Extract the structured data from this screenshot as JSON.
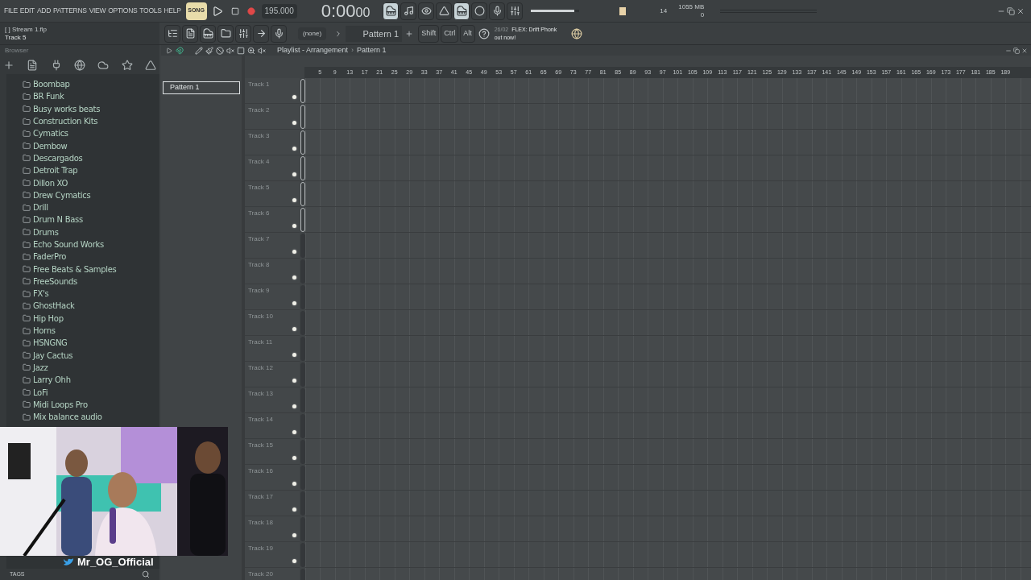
{
  "menu": [
    "FILE",
    "EDIT",
    "ADD",
    "PATTERNS",
    "VIEW",
    "OPTIONS",
    "TOOLS",
    "HELP"
  ],
  "transport": {
    "mode": "SONG",
    "tempo": "195.000",
    "time": "0:00",
    "time_sub": "00"
  },
  "master_volume": {
    "level": 0.9
  },
  "monitor": {
    "cpu": "14",
    "memory": "1055 MB",
    "polyphony": "0"
  },
  "hint": {
    "file": "[  ] Stream 1.flp",
    "line": "Track 5"
  },
  "toolbar": {
    "channel": "(none)",
    "pattern": "Pattern 1",
    "keys": [
      "Shift",
      "Ctrl",
      "Alt"
    ],
    "news_date": "26/02",
    "news": "FLEX: Drift Phonk",
    "news_line2": "out now!"
  },
  "browser": {
    "title": "Browser",
    "folders": [
      "Boombap",
      "BR Funk",
      "Busy works beats",
      "Construction Kits",
      "Cymatics",
      "Dembow",
      "Descargados",
      "Detroit Trap",
      "Dillon XO",
      "Drew Cymatics",
      "Drill",
      "Drum N Bass",
      "Drums",
      "Echo Sound Works",
      "FaderPro",
      "Free Beats & Samples",
      "FreeSounds",
      "FX's",
      "GhostHack",
      "Hip Hop",
      "Horns",
      "HSNGNG",
      "Jay Cactus",
      "Jazz",
      "Larry Ohh",
      "LoFi",
      "Midi Loops Pro",
      "Mix balance audio"
    ],
    "tags": "TAGS"
  },
  "overlay": {
    "handle": "Mr_OG_Official"
  },
  "playlist": {
    "title": "Playlist - Arrangement",
    "separator": "›",
    "pattern": "Pattern 1",
    "patterns": [
      {
        "name": "Pattern 1",
        "selected": true
      }
    ],
    "ruler": [
      "5",
      "9",
      "13",
      "17",
      "21",
      "25",
      "29",
      "33",
      "37",
      "41",
      "45",
      "49",
      "53",
      "57",
      "61",
      "65",
      "69",
      "73",
      "77",
      "81",
      "85",
      "89",
      "93",
      "97",
      "101",
      "105",
      "109",
      "113",
      "117",
      "121",
      "125",
      "129",
      "133",
      "137",
      "141",
      "145",
      "149",
      "153",
      "157",
      "161",
      "165",
      "169",
      "173",
      "177",
      "181",
      "185",
      "189"
    ],
    "tracks": [
      {
        "name": "Track 1",
        "selected": true
      },
      {
        "name": "Track 2",
        "selected": true
      },
      {
        "name": "Track 3",
        "selected": true
      },
      {
        "name": "Track 4",
        "selected": true
      },
      {
        "name": "Track 5",
        "selected": true
      },
      {
        "name": "Track 6",
        "selected": true
      },
      {
        "name": "Track 7",
        "selected": false
      },
      {
        "name": "Track 8",
        "selected": false
      },
      {
        "name": "Track 9",
        "selected": false
      },
      {
        "name": "Track 10",
        "selected": false
      },
      {
        "name": "Track 11",
        "selected": false
      },
      {
        "name": "Track 12",
        "selected": false
      },
      {
        "name": "Track 13",
        "selected": false
      },
      {
        "name": "Track 14",
        "selected": false
      },
      {
        "name": "Track 15",
        "selected": false
      },
      {
        "name": "Track 16",
        "selected": false
      },
      {
        "name": "Track 17",
        "selected": false
      },
      {
        "name": "Track 18",
        "selected": false
      },
      {
        "name": "Track 19",
        "selected": false
      },
      {
        "name": "Track 20",
        "selected": false
      }
    ]
  }
}
